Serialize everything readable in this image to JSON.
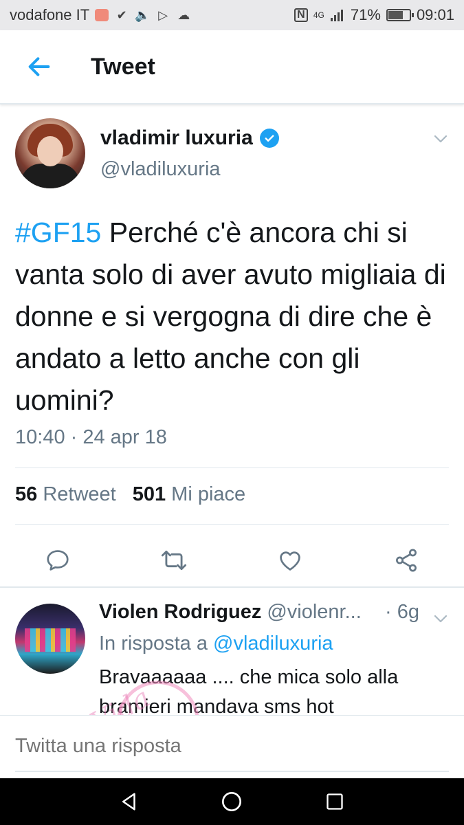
{
  "status_bar": {
    "carrier": "vodafone IT",
    "network": "4G",
    "battery_percent": "71%",
    "battery_level": 0.71,
    "time": "09:01"
  },
  "header": {
    "title": "Tweet"
  },
  "tweet": {
    "author_name": "vladimir luxuria",
    "author_handle": "@vladiluxuria",
    "hashtag": "#GF15",
    "text": " Perché c'è ancora chi si vanta solo di aver avuto migliaia di donne e si vergogna di dire che è andato a letto anche con gli uomini?",
    "timestamp": "10:40 · 24 apr 18",
    "retweet_count": "56",
    "retweet_label": "Retweet",
    "like_count": "501",
    "like_label": "Mi piace"
  },
  "reply": {
    "author_name": "Violen Rodriguez",
    "author_handle": "@violenr...",
    "time": "· 6g",
    "reply_to_prefix": "In risposta a ",
    "reply_to_mention": "@vladiluxuria",
    "text": "Bravaaaaaa .... che mica solo alla bramieri mandava sms hot"
  },
  "composer": {
    "placeholder": "Twitta una risposta"
  },
  "colors": {
    "accent": "#1da1f2",
    "secondary_text": "#657786",
    "primary_text": "#14171a",
    "divider": "#e1e8ed"
  },
  "icons": {
    "back": "arrow-left-icon",
    "verified": "verified-badge-icon",
    "reply": "comment-icon",
    "retweet": "retweet-icon",
    "like": "heart-icon",
    "share": "share-icon"
  }
}
